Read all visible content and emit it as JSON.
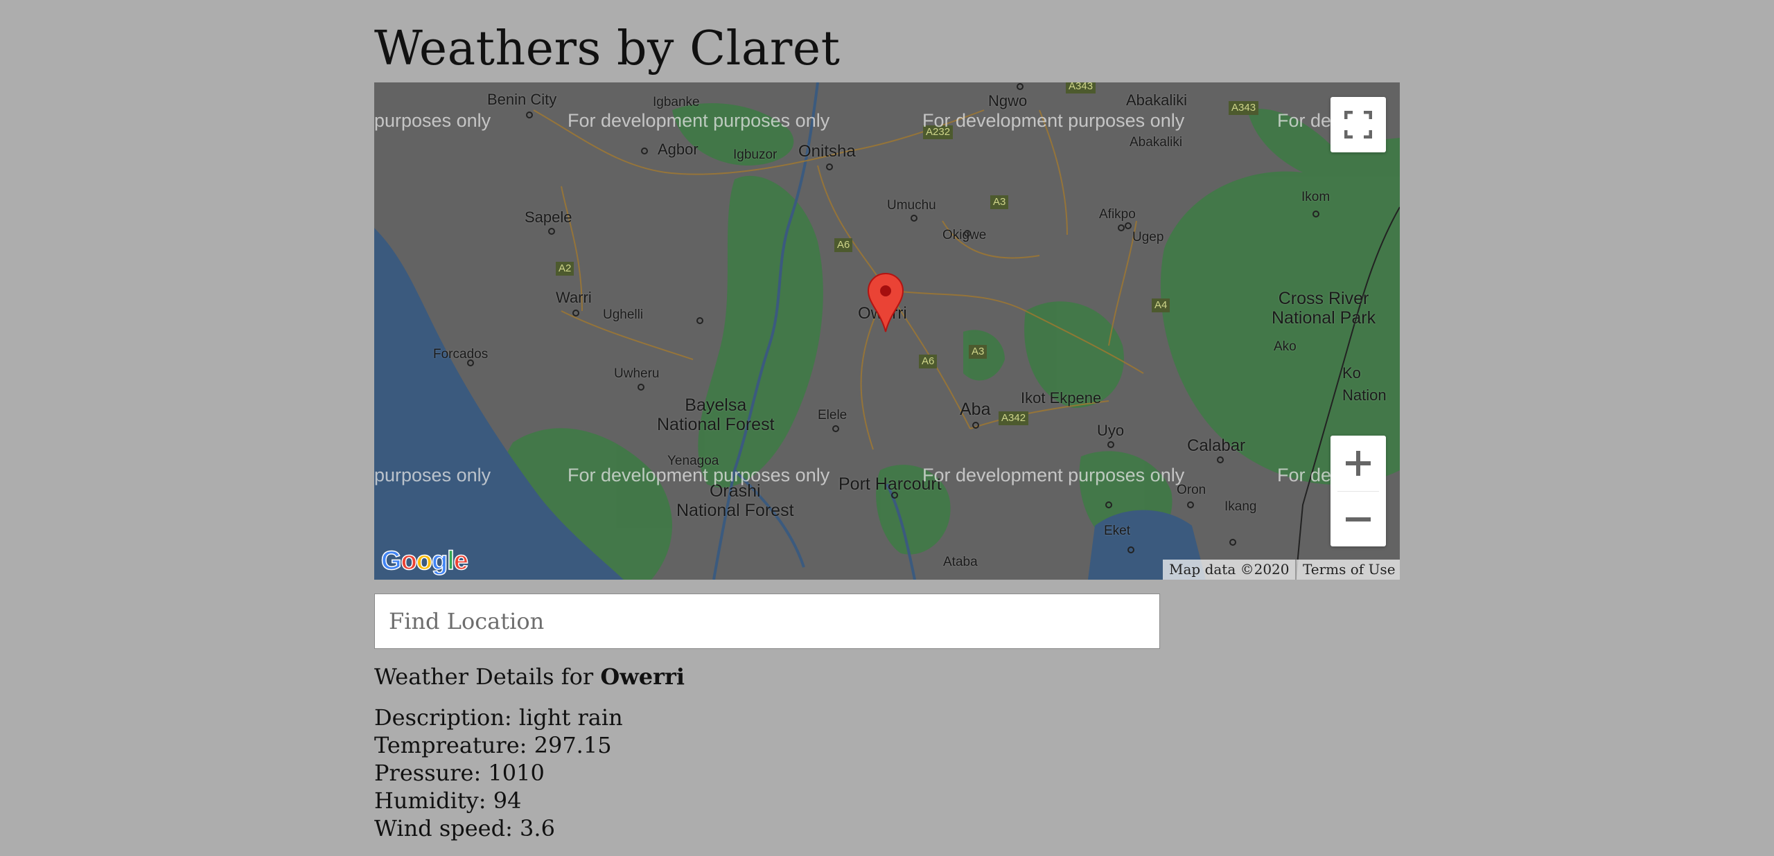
{
  "app": {
    "title": "Weathers by Claret"
  },
  "map": {
    "places": {
      "benin_city": "Benin City",
      "igbanke": "Igbanke",
      "agbor": "Agbor",
      "igbuzor": "Igbuzor",
      "onitsha": "Onitsha",
      "ngwo": "Ngwo",
      "abakaliki": "Abakaliki",
      "abakaliki2": "Abakaliki",
      "umuchu": "Umuchu",
      "afikpo": "Afikpo",
      "ikom": "Ikom",
      "sapele": "Sapele",
      "okigwe": "Okigwe",
      "ugep": "Ugep",
      "warri": "Warri",
      "ughelli": "Ughelli",
      "owerri": "Owerri",
      "cross_river": "Cross River\nNational Park",
      "ako": "Ako",
      "forcados": "Forcados",
      "uwheru": "Uwheru",
      "bayelsa": "Bayelsa\nNational Forest",
      "elele": "Elele",
      "aba": "Aba",
      "ikot_ekpene": "Ikot Ekpene",
      "uyo": "Uyo",
      "calabar": "Calabar",
      "yenagoa": "Yenagoa",
      "orashi": "Orashi\nNational Forest",
      "port_harcourt": "Port Harcourt",
      "oron": "Oron",
      "ikang": "Ikang",
      "eket": "Eket",
      "ataba": "Ataba",
      "ko_nation": "Ko\nNation"
    },
    "roads": {
      "a343": "A343",
      "a343b": "A343",
      "a232": "A232",
      "a3": "A3",
      "a6": "A6",
      "a2": "A2",
      "a4": "A4",
      "a6b": "A6",
      "a3b": "A3",
      "a342": "A342"
    },
    "watermark": "For development purposes only",
    "watermark_cut": "purposes only",
    "watermark_cut_right": "For dev",
    "attribution_data": "Map data ©2020",
    "attribution_terms": "Terms of Use",
    "google_logo": "Google",
    "colors": {
      "land": "#636363",
      "green": "#3f7a46",
      "water": "#3b5a7e",
      "marker": "#ea4335"
    }
  },
  "search": {
    "placeholder": "Find Location",
    "value": ""
  },
  "weather": {
    "heading_prefix": "Weather Details for ",
    "location": "Owerri",
    "description": "Description: light rain",
    "temperature": "Tempreature: 297.15",
    "pressure": "Pressure: 1010",
    "humidity": "Humidity: 94",
    "wind_speed": "Wind speed: 3.6"
  }
}
